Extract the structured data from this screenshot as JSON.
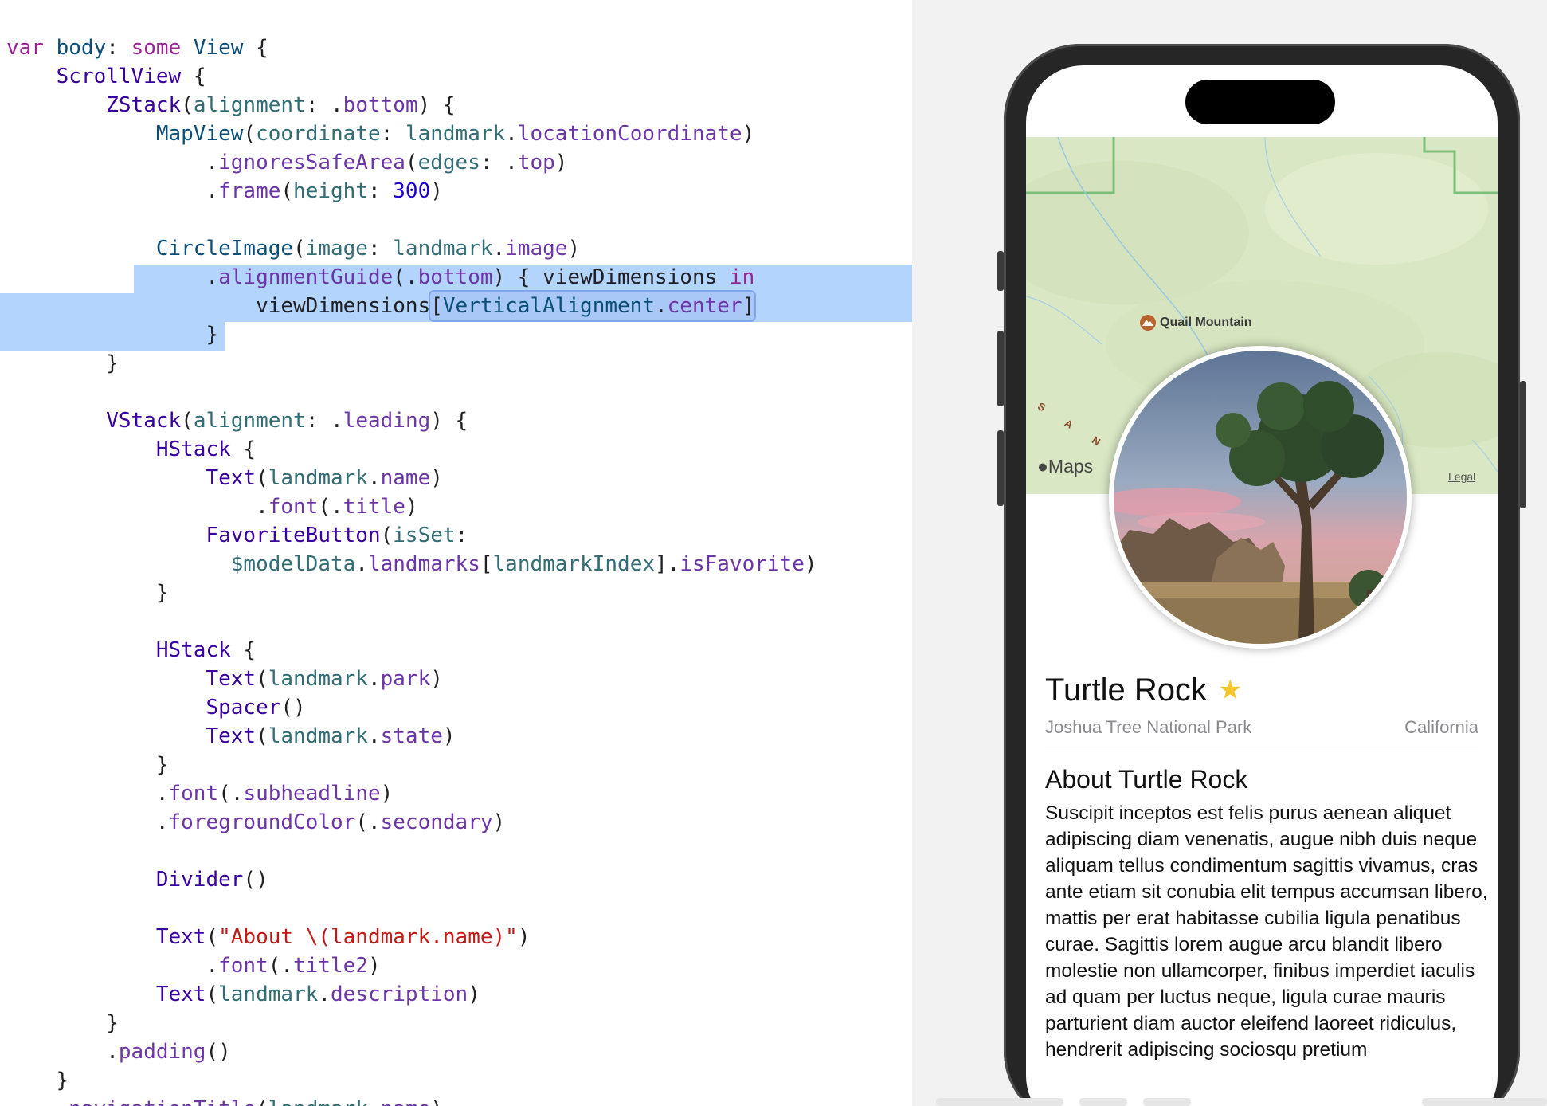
{
  "editor": {
    "lines": [
      "var body: some View {",
      "    ScrollView {",
      "        ZStack(alignment: .bottom) {",
      "            MapView(coordinate: landmark.locationCoordinate)",
      "                .ignoresSafeArea(edges: .top)",
      "                .frame(height: 300)",
      "",
      "            CircleImage(image: landmark.image)",
      "                .alignmentGuide(.bottom) { viewDimensions in",
      "                    viewDimensions[VerticalAlignment.center]",
      "                }",
      "        }",
      "",
      "        VStack(alignment: .leading) {",
      "            HStack {",
      "                Text(landmark.name)",
      "                    .font(.title)",
      "                FavoriteButton(isSet:",
      "                  $modelData.landmarks[landmarkIndex].isFavorite)",
      "            }",
      "",
      "            HStack {",
      "                Text(landmark.park)",
      "                Spacer()",
      "                Text(landmark.state)",
      "            }",
      "            .font(.subheadline)",
      "            .foregroundColor(.secondary)",
      "",
      "            Divider()",
      "",
      "            Text(\"About \\(landmark.name)\")",
      "                .font(.title2)",
      "            Text(landmark.description)",
      "        }",
      "        .padding()",
      "    }",
      "    .navigationTitle(landmark.name)"
    ]
  },
  "preview": {
    "map": {
      "place_label": "Quail Mountain",
      "curved_label": "S A N E",
      "logo": "Maps",
      "legal": "Legal"
    },
    "image_icon": "joshua-tree-photo",
    "title": "Turtle Rock",
    "favorite_icon": "★",
    "park": "Joshua Tree National Park",
    "state": "California",
    "about_heading": "About Turtle Rock",
    "description": "Suscipit inceptos est felis purus aenean aliquet adipiscing diam venenatis, augue nibh duis neque aliquam tellus condimentum sagittis vivamus, cras ante etiam sit conubia elit tempus accumsan libero, mattis per erat habitasse cubilia ligula penatibus curae. Sagittis lorem augue arcu blandit libero molestie non ullamcorper, finibus imperdiet iaculis ad quam per luctus neque, ligula curae mauris parturient diam auctor eleifend laoreet ridiculus, hendrerit adipiscing sociosqu pretium"
  },
  "colors": {
    "keyword": "#9b2393",
    "type": "#0b4f79",
    "function": "#3900a0",
    "member": "#326d74",
    "number": "#1c00cf",
    "string": "#c41a16",
    "selection": "#b3d4fc",
    "favorite_star": "#f7c52b"
  }
}
